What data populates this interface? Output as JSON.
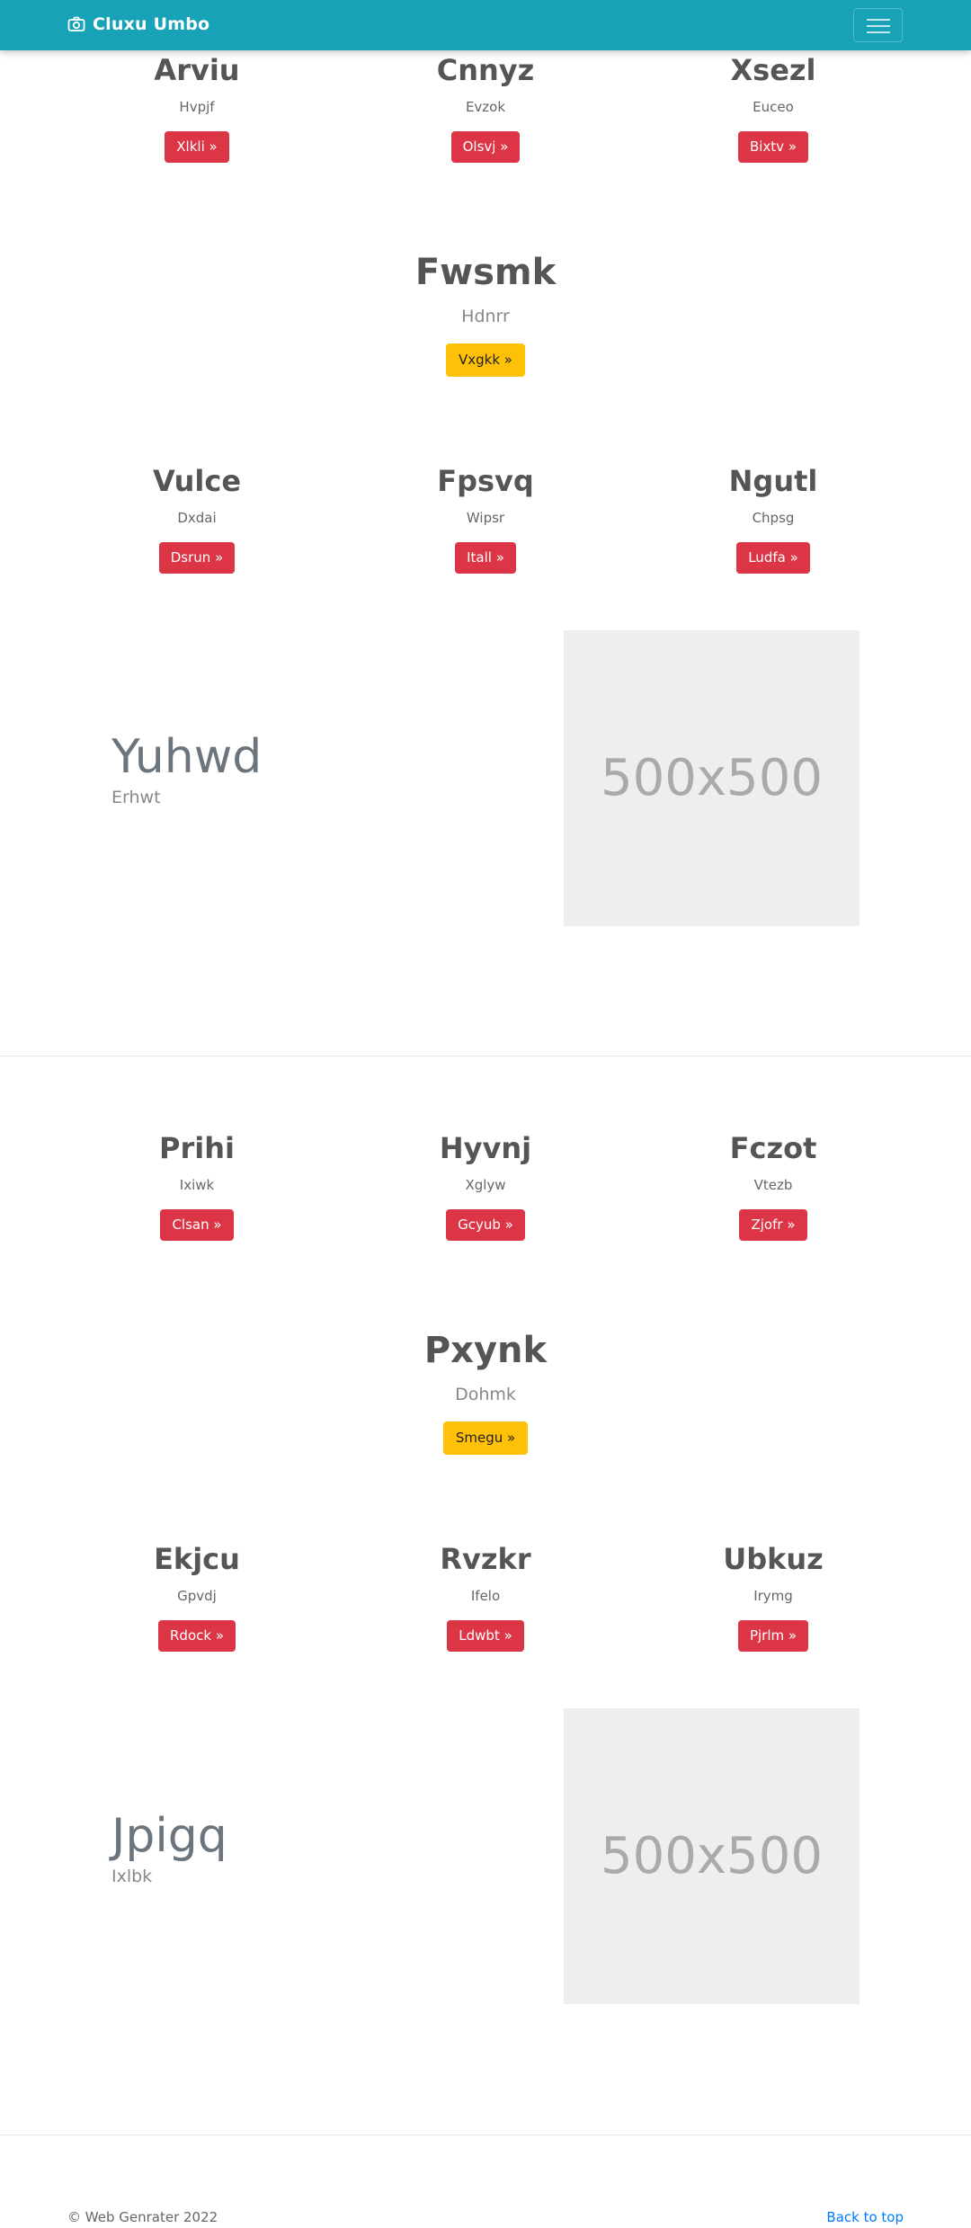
{
  "navbar": {
    "brand": "Cluxu Umbo",
    "brand_icon": "camera-icon",
    "toggler_icon": "hamburger-menu-icon"
  },
  "sections": [
    {
      "row1": [
        {
          "title": "Arviu",
          "subtitle": "Hvpjf",
          "button": "Xlkli »"
        },
        {
          "title": "Cnnyz",
          "subtitle": "Evzok",
          "button": "Olsvj »"
        },
        {
          "title": "Xsezl",
          "subtitle": "Euceo",
          "button": "Bixtv »"
        }
      ],
      "featured": {
        "title": "Fwsmk",
        "subtitle": "Hdnrr",
        "button": "Vxgkk »"
      },
      "row2": [
        {
          "title": "Vulce",
          "subtitle": "Dxdai",
          "button": "Dsrun »"
        },
        {
          "title": "Fpsvq",
          "subtitle": "Wipsr",
          "button": "Itall »"
        },
        {
          "title": "Ngutl",
          "subtitle": "Chpsg",
          "button": "Ludfa »"
        }
      ],
      "hero": {
        "title": "Yuhwd",
        "subtitle": "Erhwt",
        "image_label": "500x500"
      }
    },
    {
      "row1": [
        {
          "title": "Prihi",
          "subtitle": "Ixiwk",
          "button": "Clsan »"
        },
        {
          "title": "Hyvnj",
          "subtitle": "Xglyw",
          "button": "Gcyub »"
        },
        {
          "title": "Fczot",
          "subtitle": "Vtezb",
          "button": "Zjofr »"
        }
      ],
      "featured": {
        "title": "Pxynk",
        "subtitle": "Dohmk",
        "button": "Smegu »"
      },
      "row2": [
        {
          "title": "Ekjcu",
          "subtitle": "Gpvdj",
          "button": "Rdock »"
        },
        {
          "title": "Rvzkr",
          "subtitle": "Ifelo",
          "button": "Ldwbt »"
        },
        {
          "title": "Ubkuz",
          "subtitle": "Irymg",
          "button": "Pjrlm »"
        }
      ],
      "hero": {
        "title": "Jpigq",
        "subtitle": "Ixlbk",
        "image_label": "500x500"
      }
    }
  ],
  "footer": {
    "copyright": "© Web Genrater 2022",
    "back_to_top": "Back to top"
  },
  "colors": {
    "navbar": "#17a2b8",
    "danger": "#dc3545",
    "warning": "#ffc107",
    "link": "#007bff"
  }
}
